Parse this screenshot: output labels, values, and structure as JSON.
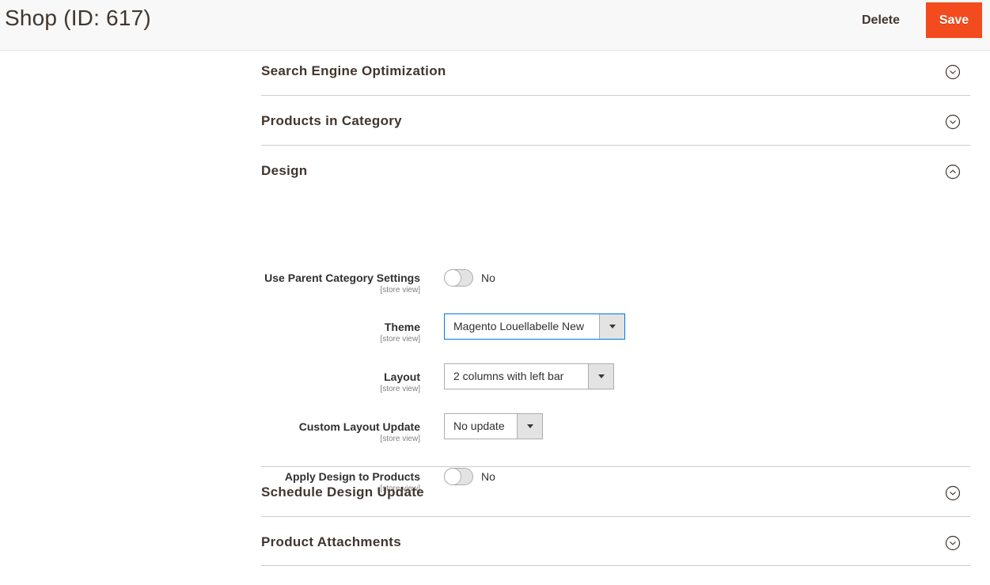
{
  "header": {
    "title": "Shop (ID: 617)",
    "delete_label": "Delete",
    "save_label": "Save",
    "save_color": "#f34b1d"
  },
  "sections": [
    {
      "title": "Search Engine Optimization",
      "state": "collapsed",
      "icon": "chevron-down-circle-icon"
    },
    {
      "title": "Products in Category",
      "state": "collapsed",
      "icon": "chevron-down-circle-icon"
    },
    {
      "title": "Design",
      "state": "expanded",
      "icon": "chevron-up-circle-icon"
    },
    {
      "title": "Schedule Design Update",
      "state": "collapsed",
      "icon": "chevron-down-circle-icon"
    },
    {
      "title": "Product Attachments",
      "state": "collapsed",
      "icon": "chevron-down-circle-icon"
    }
  ],
  "design": {
    "use_parent": {
      "label": "Use Parent Category Settings",
      "scope": "[store view]",
      "value": "No"
    },
    "theme": {
      "label": "Theme",
      "scope": "[store view]",
      "value": "Magento Louellabelle New"
    },
    "layout": {
      "label": "Layout",
      "scope": "[store view]",
      "value": "2 columns with left bar"
    },
    "custom_layout_update": {
      "label": "Custom Layout Update",
      "scope": "[store view]",
      "value": "No update"
    },
    "apply_to_products": {
      "label": "Apply Design to Products",
      "scope": "[store view]",
      "value": "No"
    }
  }
}
